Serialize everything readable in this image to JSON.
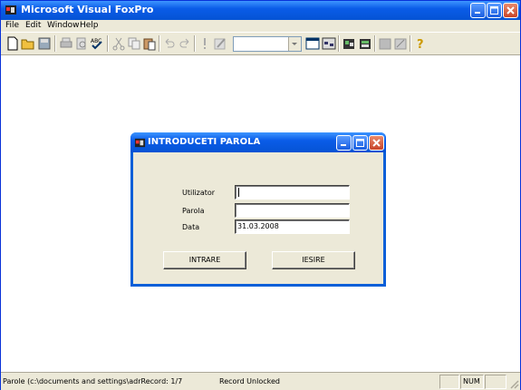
{
  "app": {
    "title": "Microsoft Visual FoxPro"
  },
  "menu": {
    "items": [
      "File",
      "Edit",
      "Window",
      "Help"
    ]
  },
  "toolbar": {
    "combo_value": ""
  },
  "dialog": {
    "title": "INTRODUCETI PAROLA",
    "fields": {
      "user_label": "Utilizator",
      "user_value": "",
      "password_label": "Parola",
      "password_value": "",
      "date_label": "Data",
      "date_value": "31.03.2008"
    },
    "buttons": {
      "enter": "INTRARE",
      "exit": "IESIRE"
    }
  },
  "status": {
    "left_text": "Parole (c:\\documents and settings\\adrRecord: 1/7",
    "lock_text": "Record Unlocked",
    "num_text": "NUM"
  }
}
